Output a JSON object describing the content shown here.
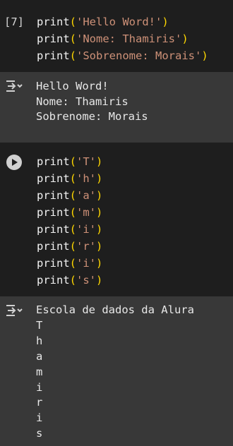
{
  "cells": [
    {
      "execution_count": "[7]",
      "code_lines": [
        {
          "fn": "print",
          "open": "(",
          "str": "'Hello Word!'",
          "close": ")"
        },
        {
          "fn": "print",
          "open": "(",
          "str": "'Nome: Thamiris'",
          "close": ")"
        },
        {
          "fn": "print",
          "open": "(",
          "str": "'Sobrenome: Morais'",
          "close": ")"
        }
      ],
      "output_icon": "output-toggle-icon",
      "output_lines": [
        "Hello Word!",
        "Nome: Thamiris",
        "Sobrenome: Morais"
      ]
    },
    {
      "run_icon": "play-icon",
      "code_lines": [
        {
          "fn": "print",
          "open": "(",
          "str": "'T'",
          "close": ")"
        },
        {
          "fn": "print",
          "open": "(",
          "str": "'h'",
          "close": ")"
        },
        {
          "fn": "print",
          "open": "(",
          "str": "'a'",
          "close": ")"
        },
        {
          "fn": "print",
          "open": "(",
          "str": "'m'",
          "close": ")"
        },
        {
          "fn": "print",
          "open": "(",
          "str": "'i'",
          "close": ")"
        },
        {
          "fn": "print",
          "open": "(",
          "str": "'r'",
          "close": ")"
        },
        {
          "fn": "print",
          "open": "(",
          "str": "'i'",
          "close": ")"
        },
        {
          "fn": "print",
          "open": "(",
          "str": "'s'",
          "close": ")"
        }
      ],
      "output_icon": "output-toggle-icon",
      "output_lines": [
        "Escola de dados da Alura",
        "T",
        "h",
        "a",
        "m",
        "i",
        "r",
        "i",
        "s"
      ]
    }
  ],
  "colors": {
    "background": "#1e1e1e",
    "output_background": "#383838",
    "function": "#f1f1f1",
    "paren": "#ffd700",
    "string": "#ce9178"
  }
}
